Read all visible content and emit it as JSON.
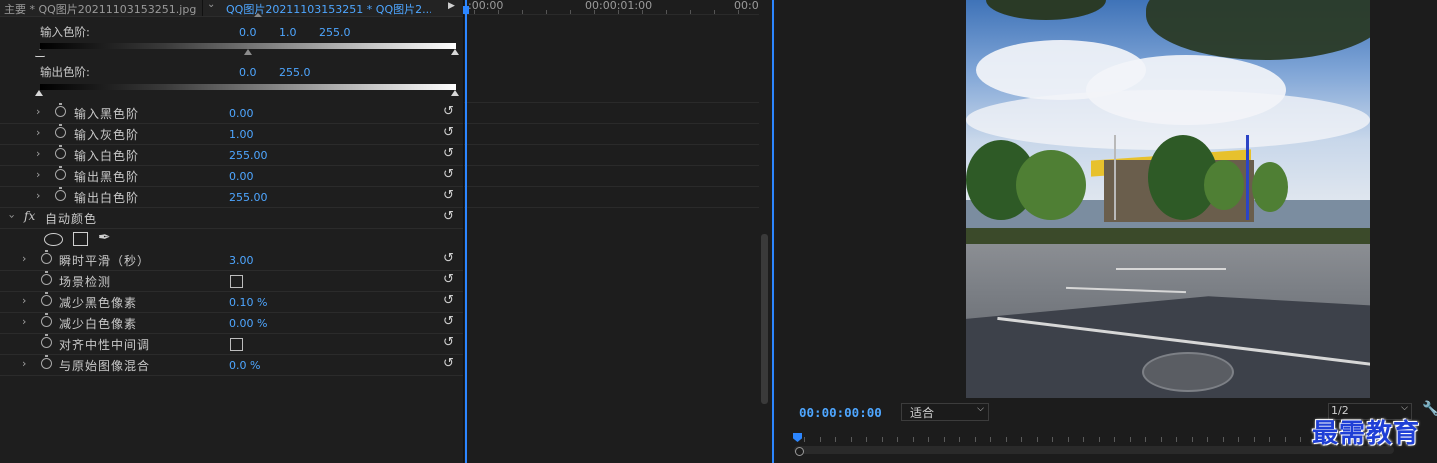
{
  "tabs": {
    "main_tab": "主要 * QQ图片20211103153251.jpg",
    "clip_tab": "QQ图片20211103153251 * QQ图片2..."
  },
  "levels": {
    "input_label": "输入色阶:",
    "input_values": [
      "0.0",
      "1.0",
      "255.0"
    ],
    "output_label": "输出色阶:",
    "output_values": [
      "0.0",
      "255.0"
    ],
    "params": [
      {
        "label": "输入黑色阶",
        "value": "0.00"
      },
      {
        "label": "输入灰色阶",
        "value": "1.00"
      },
      {
        "label": "输入白色阶",
        "value": "255.00"
      },
      {
        "label": "输出黑色阶",
        "value": "0.00"
      },
      {
        "label": "输出白色阶",
        "value": "255.00"
      }
    ]
  },
  "auto_color": {
    "fx_label": "fx",
    "title": "自动颜色",
    "params": [
      {
        "label": "瞬时平滑（秒）",
        "value": "3.00"
      },
      {
        "label": "场景检测",
        "value": ""
      },
      {
        "label": "减少黑色像素",
        "value": "0.10 %"
      },
      {
        "label": "减少白色像素",
        "value": "0.00 %"
      },
      {
        "label": "对齐中性中间调",
        "value": ""
      },
      {
        "label": "与原始图像混合",
        "value": "0.0 %"
      }
    ]
  },
  "mini_timeline": {
    "time_start": ":00:00",
    "time_mid": "00:00:01:00",
    "time_end": "00:0"
  },
  "monitor": {
    "timecode": "00:00:00:00",
    "fit_label": "适合",
    "resolution_label": "1/2"
  },
  "watermark": "最需教育",
  "colors": {
    "accent_blue": "#4ea6ff",
    "playhead_blue": "#2c86ff",
    "panel_bg": "#1e1e1e"
  }
}
